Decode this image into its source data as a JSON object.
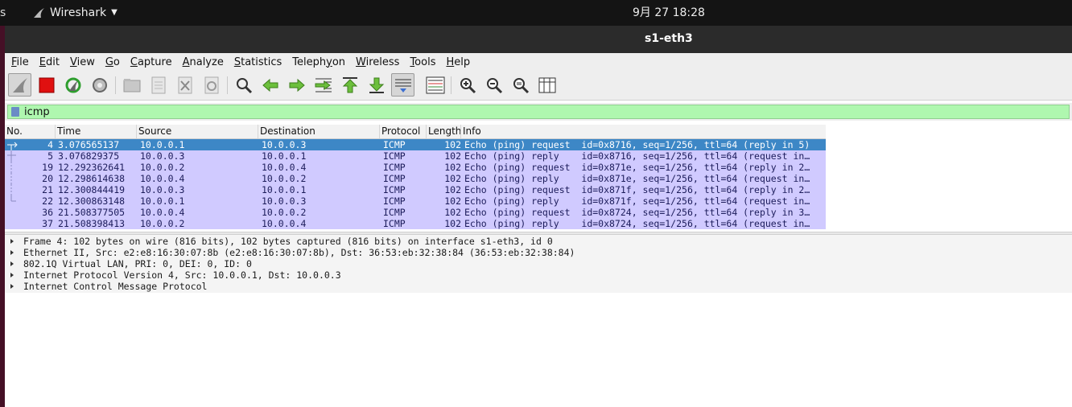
{
  "topbar": {
    "activities_fragment": "s",
    "app_name": "Wireshark",
    "clock": "9月 27  18:28"
  },
  "window": {
    "title": "s1-eth3"
  },
  "menus": [
    {
      "label": "File",
      "mnemonic": "F",
      "rest": "ile"
    },
    {
      "label": "Edit",
      "mnemonic": "E",
      "rest": "dit"
    },
    {
      "label": "View",
      "mnemonic": "V",
      "rest": "iew"
    },
    {
      "label": "Go",
      "mnemonic": "G",
      "rest": "o"
    },
    {
      "label": "Capture",
      "mnemonic": "C",
      "rest": "apture"
    },
    {
      "label": "Analyze",
      "mnemonic": "A",
      "rest": "nalyze"
    },
    {
      "label": "Statistics",
      "mnemonic": "S",
      "rest": "tatistics"
    },
    {
      "label": "Telephony",
      "mnemonic": "y",
      "pre": "Teleph",
      "mid": "on",
      "rest": ""
    },
    {
      "label": "Wireless",
      "mnemonic": "W",
      "rest": "ireless"
    },
    {
      "label": "Tools",
      "mnemonic": "T",
      "rest": "ools"
    },
    {
      "label": "Help",
      "mnemonic": "H",
      "rest": "elp"
    }
  ],
  "toolbar": {
    "buttons": [
      {
        "name": "start-capture-icon"
      },
      {
        "name": "stop-capture-icon"
      },
      {
        "name": "restart-capture-icon"
      },
      {
        "name": "capture-options-icon"
      },
      {
        "name": "open-file-icon"
      },
      {
        "name": "save-file-icon"
      },
      {
        "name": "close-file-icon"
      },
      {
        "name": "reload-file-icon"
      },
      {
        "name": "find-packet-icon"
      },
      {
        "name": "go-back-icon"
      },
      {
        "name": "go-forward-icon"
      },
      {
        "name": "go-to-packet-icon"
      },
      {
        "name": "go-first-packet-icon"
      },
      {
        "name": "go-last-packet-icon"
      },
      {
        "name": "autoscroll-icon"
      },
      {
        "name": "colorize-icon"
      },
      {
        "name": "zoom-in-icon"
      },
      {
        "name": "zoom-out-icon"
      },
      {
        "name": "zoom-normal-icon"
      },
      {
        "name": "resize-columns-icon"
      }
    ]
  },
  "filter": {
    "value": "icmp"
  },
  "packet_list": {
    "columns": [
      "No.",
      "Time",
      "Source",
      "Destination",
      "Protocol",
      "Length",
      "Info"
    ],
    "rows": [
      {
        "no": "4",
        "time": "3.076565137",
        "src": "10.0.0.1",
        "dst": "10.0.0.3",
        "proto": "ICMP",
        "len": "102",
        "info": "Echo (ping) request  id=0x8716, seq=1/256, ttl=64 (reply in 5)",
        "selected": true
      },
      {
        "no": "5",
        "time": "3.076829375",
        "src": "10.0.0.3",
        "dst": "10.0.0.1",
        "proto": "ICMP",
        "len": "102",
        "info": "Echo (ping) reply    id=0x8716, seq=1/256, ttl=64 (request in…",
        "selected": false
      },
      {
        "no": "19",
        "time": "12.292362641",
        "src": "10.0.0.2",
        "dst": "10.0.0.4",
        "proto": "ICMP",
        "len": "102",
        "info": "Echo (ping) request  id=0x871e, seq=1/256, ttl=64 (reply in 2…",
        "selected": false
      },
      {
        "no": "20",
        "time": "12.298614638",
        "src": "10.0.0.4",
        "dst": "10.0.0.2",
        "proto": "ICMP",
        "len": "102",
        "info": "Echo (ping) reply    id=0x871e, seq=1/256, ttl=64 (request in…",
        "selected": false
      },
      {
        "no": "21",
        "time": "12.300844419",
        "src": "10.0.0.3",
        "dst": "10.0.0.1",
        "proto": "ICMP",
        "len": "102",
        "info": "Echo (ping) request  id=0x871f, seq=1/256, ttl=64 (reply in 2…",
        "selected": false
      },
      {
        "no": "22",
        "time": "12.300863148",
        "src": "10.0.0.1",
        "dst": "10.0.0.3",
        "proto": "ICMP",
        "len": "102",
        "info": "Echo (ping) reply    id=0x871f, seq=1/256, ttl=64 (request in…",
        "selected": false
      },
      {
        "no": "36",
        "time": "21.508377505",
        "src": "10.0.0.4",
        "dst": "10.0.0.2",
        "proto": "ICMP",
        "len": "102",
        "info": "Echo (ping) request  id=0x8724, seq=1/256, ttl=64 (reply in 3…",
        "selected": false
      },
      {
        "no": "37",
        "time": "21.508398413",
        "src": "10.0.0.2",
        "dst": "10.0.0.4",
        "proto": "ICMP",
        "len": "102",
        "info": "Echo (ping) reply    id=0x8724, seq=1/256, ttl=64 (request in…",
        "selected": false
      }
    ]
  },
  "details": [
    "Frame 4: 102 bytes on wire (816 bits), 102 bytes captured (816 bits) on interface s1-eth3, id 0",
    "Ethernet II, Src: e2:e8:16:30:07:8b (e2:e8:16:30:07:8b), Dst: 36:53:eb:32:38:84 (36:53:eb:32:38:84)",
    "802.1Q Virtual LAN, PRI: 0, DEI: 0, ID: 0",
    "Internet Protocol Version 4, Src: 10.0.0.1, Dst: 10.0.0.3",
    "Internet Control Message Protocol"
  ],
  "colors": {
    "icmp_row": "#d0caff",
    "selected_row": "#3d87c6",
    "filter_ok": "#aff7af"
  }
}
